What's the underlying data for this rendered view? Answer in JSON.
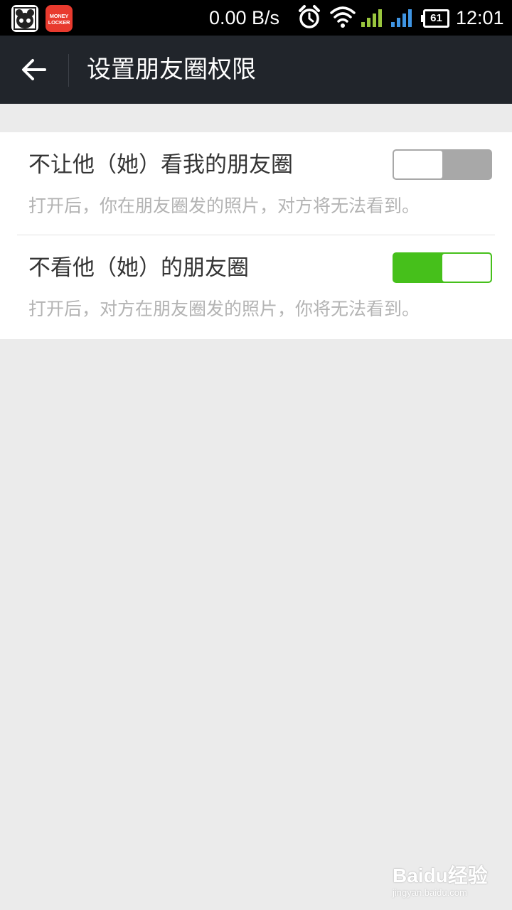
{
  "status_bar": {
    "app_icons": [
      "bear-app-icon",
      "money-locker-icon"
    ],
    "money_locker_label_line1": "MONEY",
    "money_locker_label_line2": "LOCKER",
    "net_speed": "0.00 B/s",
    "battery_level": "61",
    "time": "12:01"
  },
  "action_bar": {
    "title": "设置朋友圈权限"
  },
  "settings": [
    {
      "title": "不让他（她）看我的朋友圈",
      "description": "打开后，你在朋友圈发的照片，对方将无法看到。",
      "enabled": false
    },
    {
      "title": "不看他（她）的朋友圈",
      "description": "打开后，对方在朋友圈发的照片，你将无法看到。",
      "enabled": true
    }
  ],
  "colors": {
    "action_bar_bg": "#21252b",
    "toggle_on": "#46c01b",
    "toggle_off": "#a8a8a8",
    "page_bg": "#ebebeb"
  },
  "watermark": {
    "brand": "Baidu经验",
    "url": "jingyan.baidu.com"
  }
}
